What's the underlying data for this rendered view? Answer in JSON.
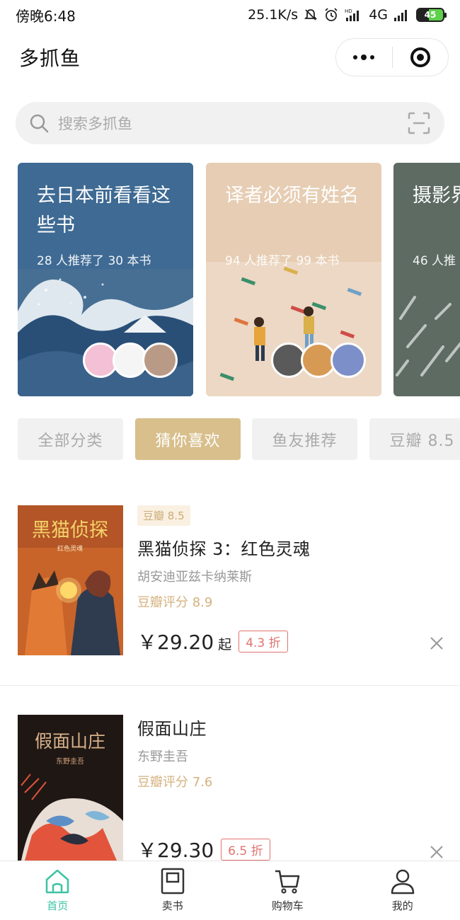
{
  "status_bar": {
    "time": "傍晚6:48",
    "network_speed": "25.1K/s",
    "network_type": "4G",
    "battery": "45",
    "icons": [
      "bell-off-icon",
      "alarm-icon",
      "hd-signal-icon",
      "cell-signal-icon",
      "battery-icon"
    ]
  },
  "header": {
    "title": "多抓鱼",
    "menu_icon": "more-dots-icon",
    "close_icon": "target-icon"
  },
  "search": {
    "placeholder": "搜索多抓鱼",
    "icon": "search-icon",
    "scan_icon": "scan-icon"
  },
  "collections": [
    {
      "title": "去日本前看看这些书",
      "subtitle": "28 人推荐了 30 本书",
      "color": "#3e6a93"
    },
    {
      "title": "译者必须有姓名",
      "subtitle": "94 人推荐了 99 本书",
      "color": "#e6cdb3"
    },
    {
      "title": "摄影界截片",
      "subtitle": "46 人推",
      "color": "#5d6b63"
    }
  ],
  "chips": [
    {
      "label": "全部分类",
      "active": false
    },
    {
      "label": "猜你喜欢",
      "active": true
    },
    {
      "label": "鱼友推荐",
      "active": false
    },
    {
      "label": "豆瓣 8.5",
      "active": false
    }
  ],
  "books": [
    {
      "badge": "豆瓣 8.5",
      "title": "黑猫侦探 3：红色灵魂",
      "author": "胡安迪亚兹卡纳莱斯",
      "rating": "豆瓣评分 8.9",
      "price": "￥29.20",
      "price_suffix": "起",
      "discount": "4.3 折",
      "cover_title": "黑猫侦探",
      "cover_subtitle": "红色灵魂"
    },
    {
      "title": "假面山庄",
      "author": "东野圭吾",
      "rating": "豆瓣评分 7.6",
      "price": "￥29.30",
      "discount": "6.5 折",
      "cover_title": "假面山庄",
      "cover_subtitle": "东野圭吾"
    }
  ],
  "tabbar": [
    {
      "label": "首页",
      "icon": "home-icon",
      "active": true
    },
    {
      "label": "卖书",
      "icon": "book-icon",
      "active": false
    },
    {
      "label": "购物车",
      "icon": "cart-icon",
      "active": false
    },
    {
      "label": "我的",
      "icon": "user-icon",
      "active": false
    }
  ],
  "colors": {
    "accent": "#3cc3a5",
    "chip_active": "#d8bf8c",
    "discount": "#e0736e",
    "rating": "#d4b27f"
  }
}
